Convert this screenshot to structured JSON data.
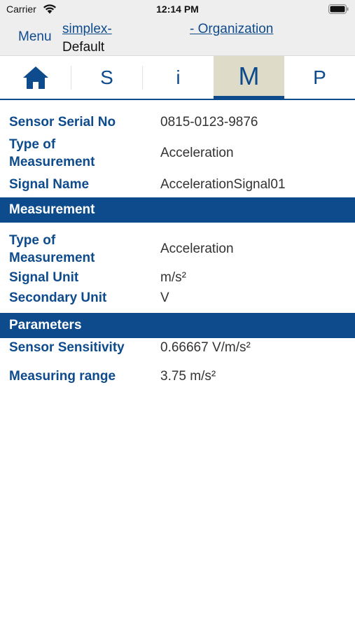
{
  "status_bar": {
    "carrier": "Carrier",
    "time": "12:14 PM",
    "wifi_icon": "wifi-icon",
    "battery_icon": "battery-icon"
  },
  "nav": {
    "menu_label": "Menu",
    "link_1": "simplex-",
    "link_1_sub": "Default",
    "link_2": "- Organization"
  },
  "tabs": [
    {
      "label": "",
      "icon": "home-icon",
      "active": false
    },
    {
      "label": "S",
      "active": false
    },
    {
      "label": "i",
      "active": false
    },
    {
      "label": "M",
      "active": true
    },
    {
      "label": "P",
      "active": false
    }
  ],
  "sensor": {
    "serial_label": "Sensor Serial No",
    "serial_value": "0815-0123-9876",
    "type_label_1": "Type of",
    "type_label_2": "Measurement",
    "type_value": "Acceleration",
    "signal_label": "Signal Name",
    "signal_value": "AccelerationSignal01"
  },
  "measurement": {
    "section_title": "Measurement",
    "type_label_1": "Type of",
    "type_label_2": "Measurement",
    "type_value": "Acceleration",
    "signal_unit_label": "Signal Unit",
    "signal_unit_value": "m/s²",
    "secondary_unit_label": "Secondary Unit",
    "secondary_unit_value": "V"
  },
  "parameters": {
    "section_title": "Parameters",
    "sensitivity_label": "Sensor Sensitivity",
    "sensitivity_value": "0.66667 V/m/s²",
    "range_label": "Measuring range",
    "range_value": "3.75 m/s²"
  },
  "colors": {
    "accent": "#0e4b8c",
    "active_tab_bg": "#dedcc9",
    "bar_bg": "#eeeeee"
  }
}
